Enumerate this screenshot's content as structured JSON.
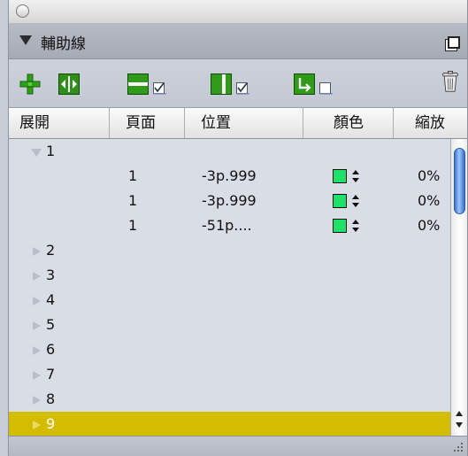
{
  "panel": {
    "title": "輔助線"
  },
  "columns": [
    "展開",
    "頁面",
    "位置",
    "顏色",
    "縮放"
  ],
  "groups": [
    {
      "label": "1",
      "expanded": true,
      "selected": false
    },
    {
      "label": "2",
      "expanded": false,
      "selected": false
    },
    {
      "label": "3",
      "expanded": false,
      "selected": false
    },
    {
      "label": "4",
      "expanded": false,
      "selected": false
    },
    {
      "label": "5",
      "expanded": false,
      "selected": false
    },
    {
      "label": "6",
      "expanded": false,
      "selected": false
    },
    {
      "label": "7",
      "expanded": false,
      "selected": false
    },
    {
      "label": "8",
      "expanded": false,
      "selected": false
    },
    {
      "label": "9",
      "expanded": false,
      "selected": true
    }
  ],
  "guides": [
    {
      "page": "1",
      "position": "-3p.999",
      "color": "#1fe06a",
      "zoom": "0%"
    },
    {
      "page": "1",
      "position": "-3p.999",
      "color": "#1fe06a",
      "zoom": "0%"
    },
    {
      "page": "1",
      "position": "-51p....",
      "color": "#1fe06a",
      "zoom": "0%"
    }
  ],
  "toolbar_icons": [
    "add-guide-icon",
    "split-guides-icon",
    "horizontal-guide-toggle-icon",
    "vertical-guide-toggle-icon",
    "lock-guide-toggle-icon",
    "trash-icon"
  ],
  "colors": {
    "selected_row": "#d4bd00",
    "list_bg": "#d9dde6",
    "swatch": "#1fe06a"
  }
}
